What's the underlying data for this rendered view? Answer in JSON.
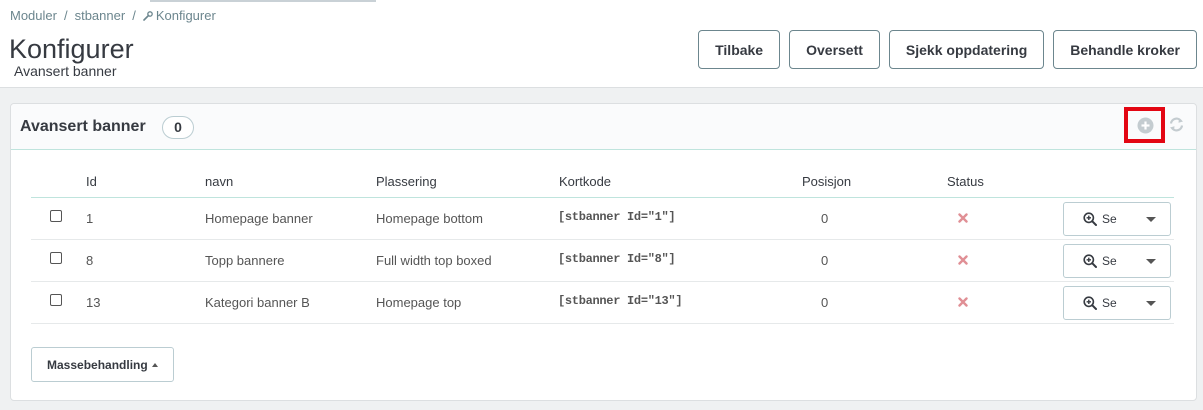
{
  "breadcrumb": {
    "items": [
      "Moduler",
      "stbanner",
      "Konfigurer"
    ],
    "separator": "/"
  },
  "header": {
    "title": "Konfigurer",
    "subtitle": "Avansert banner"
  },
  "toolbar": {
    "buttons": [
      "Tilbake",
      "Oversett",
      "Sjekk oppdatering",
      "Behandle kroker"
    ]
  },
  "panel": {
    "title": "Avansert banner",
    "count": "0",
    "add_icon": "plus-circle-icon",
    "refresh_icon": "refresh-icon",
    "highlight_color": "#e30613"
  },
  "table": {
    "columns": [
      "Id",
      "navn",
      "Plassering",
      "Kortkode",
      "Posisjon",
      "Status"
    ],
    "rows": [
      {
        "id": "1",
        "name": "Homepage banner",
        "placement": "Homepage bottom",
        "shortcode": "[stbanner Id=\"1\"]",
        "position": "0",
        "status": "disabled"
      },
      {
        "id": "8",
        "name": "Topp bannere",
        "placement": "Full width top boxed",
        "shortcode": "[stbanner Id=\"8\"]",
        "position": "0",
        "status": "disabled"
      },
      {
        "id": "13",
        "name": "Kategori banner B",
        "placement": "Homepage top",
        "shortcode": "[stbanner Id=\"13\"]",
        "position": "0",
        "status": "disabled"
      }
    ],
    "row_action_label": "Se",
    "status_color": "#e08f95"
  },
  "bulk": {
    "label": "Massebehandling"
  }
}
